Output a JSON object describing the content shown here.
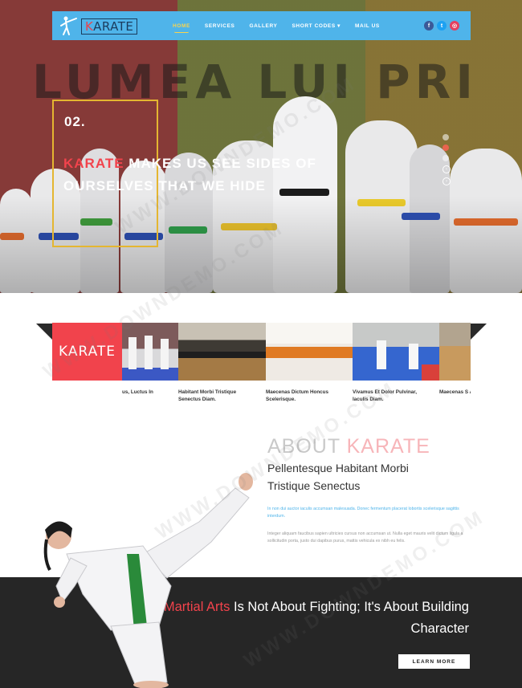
{
  "navbar": {
    "logo": {
      "prefix": "K",
      "text": "ARATE"
    },
    "menu": [
      {
        "label": "Home",
        "active": true
      },
      {
        "label": "Services",
        "active": false
      },
      {
        "label": "Gallery",
        "active": false
      },
      {
        "label": "Short Codes ▾",
        "active": false
      },
      {
        "label": "Mail Us",
        "active": false
      }
    ],
    "social": [
      {
        "icon": "facebook-icon",
        "glyph": "f",
        "color": "#3b5998"
      },
      {
        "icon": "twitter-icon",
        "glyph": "t",
        "color": "#1da1f2"
      },
      {
        "icon": "instagram-icon",
        "glyph": "◎",
        "color": "#e4405f"
      }
    ]
  },
  "hero": {
    "banner_text": "LUMEA LUI PRI",
    "slide_number": "02.",
    "title_highlight": "Karate",
    "title_rest": " makes us see sides of ourselves that we hide"
  },
  "slider": {
    "dots": 4,
    "active_dot": 2,
    "prev_icon": "‹",
    "next_icon": "›"
  },
  "gallery": {
    "label": "KARATE",
    "captions": [
      {
        "text": "us, Luctus In"
      },
      {
        "text": "Habitant Morbi Tristique Senectus Diam."
      },
      {
        "text": "Maecenas Dictum Honcus Scelerisque."
      },
      {
        "text": "Vivamus Et Dolor Pulvinar, Iaculis Diam."
      },
      {
        "text": "Maecenas S Accumsan F"
      }
    ]
  },
  "about": {
    "title_plain": "About ",
    "title_highlight": "Karate",
    "subtitle": "Pellentesque Habitant Morbi Tristique Senectus",
    "text_blue": "In non dui auctor iaculis accumsan malesuada. Donec fermentum placerat lobortis scelerisque sagittis interdum.",
    "text_gray": "Integer aliquam faucibus sapien ultricies cursus non accumsan ut. Nulla eget mauris velit dictum ligula a sollicitudin porta, justo dui dapibus purus, mattis vehicula ex nibh eu felis."
  },
  "cta": {
    "quote_highlight": "Martial Arts",
    "quote_rest": " Is Not About Fighting; It's About Building Character",
    "button_label": "Learn More"
  },
  "colors": {
    "nav_blue": "#4fb4ea",
    "accent_red": "#f2434c",
    "accent_yellow": "#e4b631",
    "dark": "#262626"
  }
}
